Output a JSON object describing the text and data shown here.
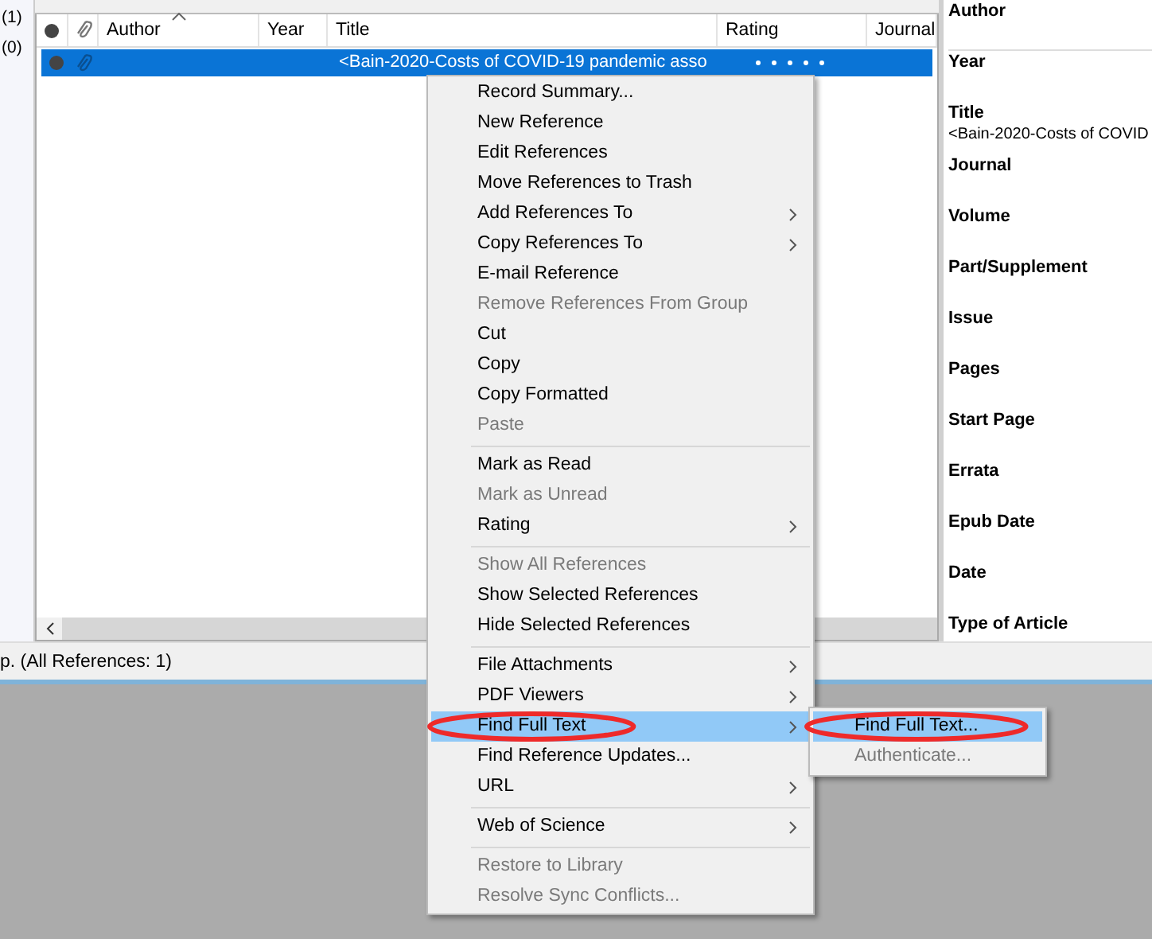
{
  "groups_panel": {
    "counts": [
      "(1)",
      "(0)"
    ]
  },
  "table": {
    "columns": [
      {
        "kind": "read"
      },
      {
        "kind": "attachment"
      },
      {
        "kind": "text",
        "label": "Author",
        "sorted": true
      },
      {
        "kind": "text",
        "label": "Year",
        "sorted": false
      },
      {
        "kind": "text",
        "label": "Title",
        "sorted": false
      },
      {
        "kind": "text",
        "label": "Rating",
        "sorted": false
      },
      {
        "kind": "text",
        "label": "Journal",
        "sorted": false
      }
    ],
    "rows": [
      {
        "selected": true,
        "read": false,
        "attached": true,
        "title": "<Bain-2020-Costs of COVID-19 pandemic asso"
      }
    ]
  },
  "status_bar": "p. (All References: 1)",
  "reference_panel": {
    "fields": [
      {
        "label": "Author",
        "kind": "field"
      },
      {
        "label": "Year"
      },
      {
        "label": "Title",
        "value": "<Bain-2020-Costs of COVID"
      },
      {
        "label": "Journal"
      },
      {
        "label": "Volume"
      },
      {
        "label": "Part/Supplement"
      },
      {
        "label": "Issue"
      },
      {
        "label": "Pages"
      },
      {
        "label": "Start Page"
      },
      {
        "label": "Errata"
      },
      {
        "label": "Epub Date"
      },
      {
        "label": "Date"
      },
      {
        "label": "Type of Article"
      }
    ]
  },
  "context_menu": {
    "items": [
      {
        "kind": "item",
        "label": "Record Summary...",
        "disabled": false,
        "selected": false
      },
      {
        "kind": "item",
        "label": "New Reference",
        "disabled": false,
        "selected": false
      },
      {
        "kind": "item",
        "label": "Edit References",
        "disabled": false,
        "selected": false
      },
      {
        "kind": "item",
        "label": "Move References to Trash",
        "disabled": false,
        "selected": false
      },
      {
        "kind": "submenu",
        "label": "Add References To",
        "disabled": false,
        "selected": false
      },
      {
        "kind": "submenu",
        "label": "Copy References To",
        "disabled": false,
        "selected": false
      },
      {
        "kind": "item",
        "label": "E-mail Reference",
        "disabled": false,
        "selected": false
      },
      {
        "kind": "item",
        "label": "Remove References From Group",
        "disabled": true,
        "selected": false
      },
      {
        "kind": "item",
        "label": "Cut",
        "disabled": false,
        "selected": false
      },
      {
        "kind": "item",
        "label": "Copy",
        "disabled": false,
        "selected": false
      },
      {
        "kind": "item",
        "label": "Copy Formatted",
        "disabled": false,
        "selected": false
      },
      {
        "kind": "item",
        "label": "Paste",
        "disabled": true,
        "selected": false
      },
      {
        "kind": "separator"
      },
      {
        "kind": "item",
        "label": "Mark as Read",
        "disabled": false,
        "selected": false
      },
      {
        "kind": "item",
        "label": "Mark as Unread",
        "disabled": true,
        "selected": false
      },
      {
        "kind": "submenu",
        "label": "Rating",
        "disabled": false,
        "selected": false
      },
      {
        "kind": "separator"
      },
      {
        "kind": "item",
        "label": "Show All References",
        "disabled": true,
        "selected": false
      },
      {
        "kind": "item",
        "label": "Show Selected References",
        "disabled": false,
        "selected": false
      },
      {
        "kind": "item",
        "label": "Hide Selected References",
        "disabled": false,
        "selected": false
      },
      {
        "kind": "separator"
      },
      {
        "kind": "submenu",
        "label": "File Attachments",
        "disabled": false,
        "selected": false
      },
      {
        "kind": "submenu",
        "label": "PDF Viewers",
        "disabled": false,
        "selected": false
      },
      {
        "kind": "submenu",
        "label": "Find Full Text",
        "disabled": false,
        "selected": true,
        "circled": true
      },
      {
        "kind": "item",
        "label": "Find Reference Updates...",
        "disabled": false,
        "selected": false
      },
      {
        "kind": "submenu",
        "label": "URL",
        "disabled": false,
        "selected": false
      },
      {
        "kind": "separator"
      },
      {
        "kind": "submenu",
        "label": "Web of Science",
        "disabled": false,
        "selected": false
      },
      {
        "kind": "separator"
      },
      {
        "kind": "item",
        "label": "Restore to Library",
        "disabled": true,
        "selected": false
      },
      {
        "kind": "item",
        "label": "Resolve Sync Conflicts...",
        "disabled": true,
        "selected": false
      }
    ]
  },
  "submenu": {
    "items": [
      {
        "label": "Find Full Text...",
        "disabled": false,
        "selected": true,
        "circled": true
      },
      {
        "label": "Authenticate...",
        "disabled": true,
        "selected": false
      }
    ]
  }
}
